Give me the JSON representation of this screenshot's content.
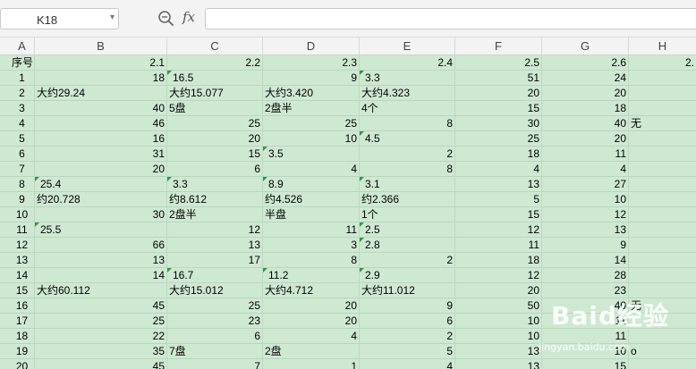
{
  "formula_bar": {
    "cell_ref": "K18",
    "fx_label": "fx",
    "formula_value": ""
  },
  "columns": [
    "A",
    "B",
    "C",
    "D",
    "E",
    "F",
    "G",
    "H"
  ],
  "rows": [
    {
      "cells": [
        "序号",
        "2.1",
        "2.2",
        "2.3",
        "2.4",
        "2.5",
        "2.6",
        "2."
      ],
      "flags": [
        false,
        false,
        false,
        false,
        false,
        false,
        false,
        false
      ]
    },
    {
      "cells": [
        "1",
        "18",
        "16.5",
        "9",
        "3.3",
        "51",
        "24",
        ""
      ],
      "flags": [
        false,
        false,
        true,
        false,
        true,
        false,
        false,
        false
      ]
    },
    {
      "cells": [
        "2",
        "大约29.24",
        "大约15.077",
        "大约3.420",
        "大约4.323",
        "20",
        "20",
        ""
      ],
      "flags": [
        false,
        false,
        false,
        false,
        false,
        false,
        false,
        false
      ]
    },
    {
      "cells": [
        "3",
        "40",
        "5盘",
        "2盘半",
        "4个",
        "15",
        "18",
        ""
      ],
      "flags": [
        false,
        false,
        false,
        false,
        false,
        false,
        false,
        false
      ]
    },
    {
      "cells": [
        "4",
        "46",
        "25",
        "25",
        "8",
        "30",
        "40",
        "无"
      ],
      "flags": [
        false,
        false,
        false,
        false,
        false,
        false,
        false,
        false
      ]
    },
    {
      "cells": [
        "5",
        "16",
        "20",
        "10",
        "4.5",
        "25",
        "20",
        ""
      ],
      "flags": [
        false,
        false,
        false,
        false,
        true,
        false,
        false,
        false
      ]
    },
    {
      "cells": [
        "6",
        "31",
        "15",
        "3.5",
        "2",
        "18",
        "11",
        ""
      ],
      "flags": [
        false,
        false,
        false,
        true,
        false,
        false,
        false,
        false
      ]
    },
    {
      "cells": [
        "7",
        "20",
        "6",
        "4",
        "8",
        "4",
        "4",
        ""
      ],
      "flags": [
        false,
        false,
        false,
        false,
        false,
        false,
        false,
        false
      ]
    },
    {
      "cells": [
        "8",
        "25.4",
        "3.3",
        "8.9",
        "3.1",
        "13",
        "27",
        ""
      ],
      "flags": [
        false,
        true,
        true,
        true,
        true,
        false,
        false,
        false
      ]
    },
    {
      "cells": [
        "9",
        "约20.728",
        "约8.612",
        "约4.526",
        "约2.366",
        "5",
        "10",
        ""
      ],
      "flags": [
        false,
        false,
        false,
        false,
        false,
        false,
        false,
        false
      ]
    },
    {
      "cells": [
        "10",
        "30",
        "2盘半",
        "半盘",
        "1个",
        "15",
        "12",
        ""
      ],
      "flags": [
        false,
        false,
        false,
        false,
        false,
        false,
        false,
        false
      ]
    },
    {
      "cells": [
        "11",
        "25.5",
        "12",
        "11",
        "2.5",
        "12",
        "13",
        ""
      ],
      "flags": [
        false,
        true,
        false,
        false,
        true,
        false,
        false,
        false
      ]
    },
    {
      "cells": [
        "12",
        "66",
        "13",
        "3",
        "2.8",
        "11",
        "9",
        ""
      ],
      "flags": [
        false,
        false,
        false,
        false,
        true,
        false,
        false,
        false
      ]
    },
    {
      "cells": [
        "13",
        "13",
        "17",
        "8",
        "2",
        "18",
        "14",
        ""
      ],
      "flags": [
        false,
        false,
        false,
        false,
        false,
        false,
        false,
        false
      ]
    },
    {
      "cells": [
        "14",
        "14",
        "16.7",
        "11.2",
        "2.9",
        "12",
        "28",
        ""
      ],
      "flags": [
        false,
        false,
        true,
        true,
        true,
        false,
        false,
        false
      ]
    },
    {
      "cells": [
        "15",
        "大约60.112",
        "大约15.012",
        "大约4.712",
        "大约11.012",
        "20",
        "23",
        ""
      ],
      "flags": [
        false,
        false,
        false,
        false,
        false,
        false,
        false,
        false
      ]
    },
    {
      "cells": [
        "16",
        "45",
        "25",
        "20",
        "9",
        "50",
        "40",
        "无"
      ],
      "flags": [
        false,
        false,
        false,
        false,
        false,
        false,
        false,
        false
      ]
    },
    {
      "cells": [
        "17",
        "25",
        "23",
        "20",
        "6",
        "10",
        "11",
        ""
      ],
      "flags": [
        false,
        false,
        false,
        false,
        false,
        false,
        false,
        false
      ]
    },
    {
      "cells": [
        "18",
        "22",
        "6",
        "4",
        "2",
        "10",
        "11",
        ""
      ],
      "flags": [
        false,
        false,
        false,
        false,
        false,
        false,
        false,
        false
      ]
    },
    {
      "cells": [
        "19",
        "35",
        "7盘",
        "2盘",
        "5",
        "13",
        "10",
        "o"
      ],
      "flags": [
        false,
        false,
        false,
        false,
        false,
        false,
        false,
        false
      ]
    },
    {
      "cells": [
        "20",
        "45",
        "7",
        "1",
        "4",
        "13",
        "15",
        ""
      ],
      "flags": [
        false,
        false,
        false,
        false,
        false,
        false,
        false,
        false
      ]
    }
  ],
  "watermark": {
    "logo": "Baid经验",
    "url": "jingyan.baidu.com"
  },
  "colors": {
    "cell_fill": "#cfe8d2",
    "flag": "#2e9a3a"
  }
}
